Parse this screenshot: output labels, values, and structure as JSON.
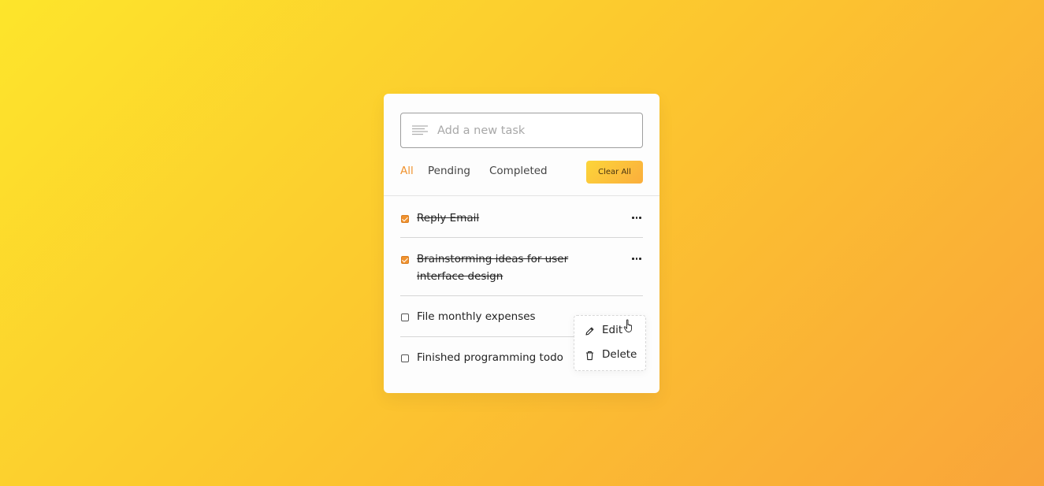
{
  "input": {
    "placeholder": "Add a new task",
    "value": ""
  },
  "filters": {
    "all": "All",
    "pending": "Pending",
    "completed": "Completed",
    "active": "All"
  },
  "clear_all_label": "Clear All",
  "tasks": [
    {
      "text": "Reply Email",
      "completed": true
    },
    {
      "text": "Brainstorming ideas for user interface design",
      "completed": true
    },
    {
      "text": "File monthly expenses",
      "completed": false
    },
    {
      "text": "Finished programming todo",
      "completed": false
    }
  ],
  "context_menu": {
    "edit_label": "Edit",
    "delete_label": "Delete"
  },
  "icons": {
    "input": "text-lines-icon",
    "task_menu": "more-horizontal-icon",
    "edit": "pencil-icon",
    "delete": "trash-icon",
    "cursor": "hand-pointer-icon"
  },
  "colors": {
    "accent": "#f0922e",
    "background_start": "#fde52b",
    "background_end": "#f9a43a"
  }
}
